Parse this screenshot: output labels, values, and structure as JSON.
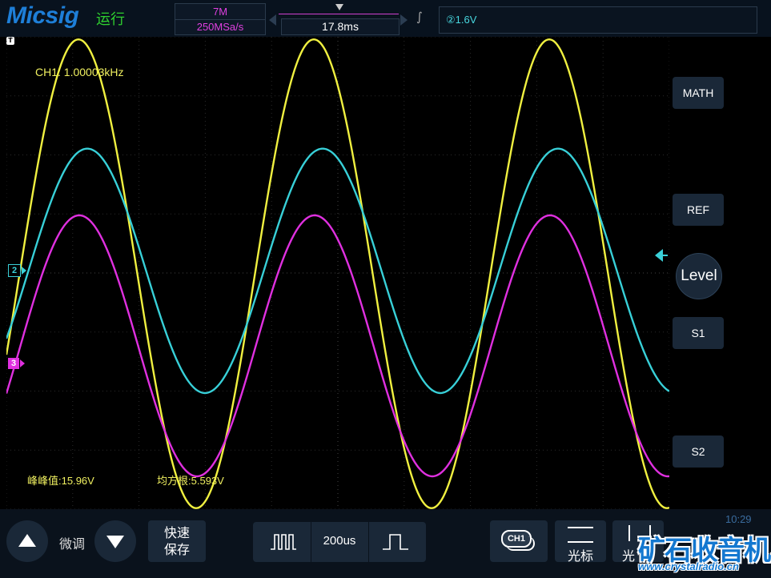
{
  "brand": "Micsig",
  "status": {
    "run_state": "运行"
  },
  "acquisition": {
    "memory_depth": "7M",
    "sample_rate": "250MSa/s"
  },
  "timebase": {
    "offset": "17.8ms",
    "scale": "200us"
  },
  "trigger": {
    "channel_marker": "②",
    "level": "②1.6V",
    "flag": "T"
  },
  "measurements": {
    "frequency": "CH1: 1.00003kHz",
    "peak_to_peak_label": "峰峰值:",
    "peak_to_peak_value": "15.96V",
    "rms_label": "均方根:",
    "rms_value": "5.593V"
  },
  "channel_markers": {
    "ch2": "2",
    "ch3": "3"
  },
  "side_menu": {
    "math": "MATH",
    "ref": "REF",
    "level": "Level",
    "s1": "S1",
    "s2": "S2"
  },
  "bottom_bar": {
    "fine_tune": "微调",
    "quick_save_line1": "快速",
    "quick_save_line2": "保存",
    "channel_button": "CH1",
    "cursor": "光标",
    "cursor2": "光"
  },
  "clock": "10:29",
  "watermark": {
    "text": "矿石收音机",
    "url": "www.crystalradio.cn"
  },
  "colors": {
    "ch1": "#f0f040",
    "ch2": "#38d0d8",
    "ch3": "#e030e0",
    "accent": "#1e7fd8",
    "run": "#2fd02f"
  },
  "icons": [
    "up-arrow-icon",
    "down-arrow-icon",
    "multi-pulse-icon",
    "single-pulse-icon",
    "channel-icon",
    "horizontal-cursor-icon",
    "vertical-cursor-icon",
    "trigger-edge-icon"
  ],
  "waveforms": [
    {
      "name": "CH1",
      "color": "#f0f040",
      "period_ms": 1.0,
      "amplitude_div": 3.97,
      "offset_div": 0,
      "phase_deg": 90
    },
    {
      "name": "CH2",
      "color": "#38d0d8",
      "period_ms": 1.0,
      "amplitude_div": 2.07,
      "offset_div": 0.05,
      "phase_deg": -90
    },
    {
      "name": "CH3",
      "color": "#e030e0",
      "period_ms": 1.0,
      "amplitude_div": 2.21,
      "offset_div": -1.22,
      "phase_deg": 0
    }
  ]
}
